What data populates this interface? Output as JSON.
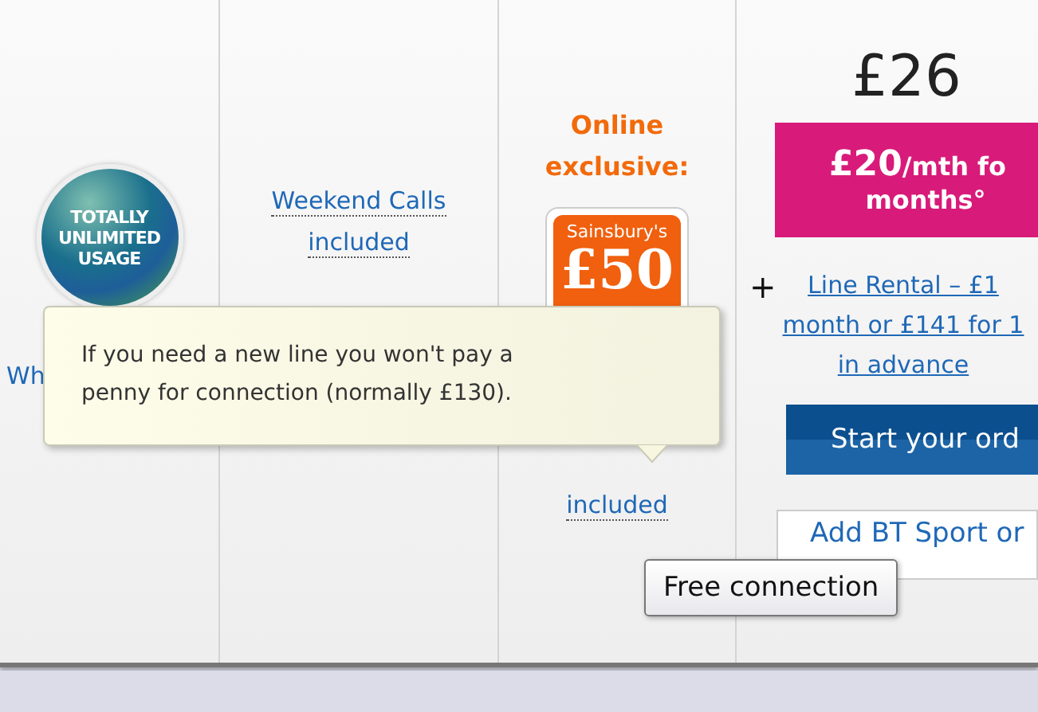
{
  "columns": [
    {
      "kind": "badge",
      "badge_lines": [
        "TOTALLY",
        "UNLIMITED",
        "USAGE"
      ],
      "link_lines": [
        "Wh"
      ]
    },
    {
      "kind": "link",
      "link_lines": [
        "Weekend Calls",
        "included"
      ]
    },
    {
      "kind": "offer",
      "heading_lines": [
        "Online",
        "exclusive:"
      ],
      "card_brand": "Sainsbury's",
      "card_amount": "£50",
      "link_lines": [
        "included"
      ]
    },
    {
      "kind": "price",
      "price": "£26",
      "promo_amount": "£20",
      "promo_rest": "/mth fo",
      "promo_line2": "months°",
      "plus": "+",
      "rental_lines": [
        "Line Rental – £1",
        "month or £141 for 1",
        "in advance"
      ],
      "order_button": "Start your ord",
      "addon_button": "Add BT Sport or"
    }
  ],
  "info_tooltip": {
    "lines": [
      "If you need a new line you won't pay a",
      "penny for connection (normally £130)."
    ]
  },
  "hover_tooltip": {
    "text": "Free connection"
  }
}
